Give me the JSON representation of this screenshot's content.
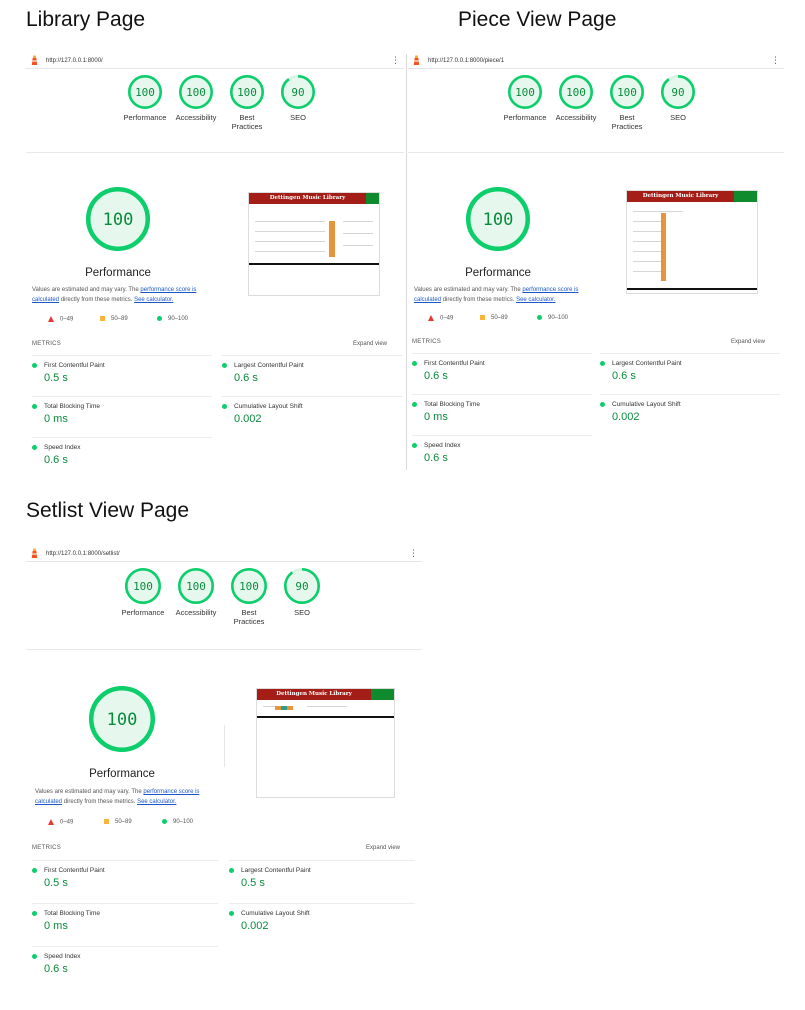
{
  "headings": {
    "library": "Library Page",
    "piece": "Piece View Page",
    "setlist": "Setlist View Page"
  },
  "common": {
    "gauge_labels": [
      "Performance",
      "Accessibility",
      "Best Practices",
      "SEO"
    ],
    "big_label": "Performance",
    "note_prefix": "Values are estimated and may vary. The ",
    "note_link": "performance score is calculated",
    "note_suffix": " directly from these metrics. ",
    "note_calc": "See calculator.",
    "legend": [
      "0–49",
      "50–89",
      "90–100"
    ],
    "metrics_title": "METRICS",
    "expand": "Expand view",
    "thumb_title": "Dettingen Music Library",
    "colors": {
      "pass": "#0cce6b",
      "pass_fill": "#e6f8ee",
      "pass_text": "#0a8b3c",
      "header_red": "#a51d17",
      "header_green": "#0f8a2d"
    }
  },
  "reports": [
    {
      "id": "library",
      "url": "http://127.0.0.1:8000/",
      "scores": [
        "100",
        "100",
        "100",
        "90"
      ],
      "score_values": [
        100,
        100,
        100,
        90
      ],
      "big_score": "100",
      "metrics": [
        {
          "label": "First Contentful Paint",
          "value": "0.5 s"
        },
        {
          "label": "Largest Contentful Paint",
          "value": "0.6 s"
        },
        {
          "label": "Total Blocking Time",
          "value": "0 ms"
        },
        {
          "label": "Cumulative Layout Shift",
          "value": "0.002"
        },
        {
          "label": "Speed Index",
          "value": "0.6 s"
        }
      ]
    },
    {
      "id": "piece",
      "url": "http://127.0.0.1:8000/piece/1",
      "scores": [
        "100",
        "100",
        "100",
        "90"
      ],
      "score_values": [
        100,
        100,
        100,
        90
      ],
      "big_score": "100",
      "metrics": [
        {
          "label": "First Contentful Paint",
          "value": "0.6 s"
        },
        {
          "label": "Largest Contentful Paint",
          "value": "0.6 s"
        },
        {
          "label": "Total Blocking Time",
          "value": "0 ms"
        },
        {
          "label": "Cumulative Layout Shift",
          "value": "0.002"
        },
        {
          "label": "Speed Index",
          "value": "0.6 s"
        }
      ]
    },
    {
      "id": "setlist",
      "url": "http://127.0.0.1:8000/setlist/",
      "scores": [
        "100",
        "100",
        "100",
        "90"
      ],
      "score_values": [
        100,
        100,
        100,
        90
      ],
      "big_score": "100",
      "metrics": [
        {
          "label": "First Contentful Paint",
          "value": "0.5 s"
        },
        {
          "label": "Largest Contentful Paint",
          "value": "0.5 s"
        },
        {
          "label": "Total Blocking Time",
          "value": "0 ms"
        },
        {
          "label": "Cumulative Layout Shift",
          "value": "0.002"
        },
        {
          "label": "Speed Index",
          "value": "0.6 s"
        }
      ]
    }
  ]
}
